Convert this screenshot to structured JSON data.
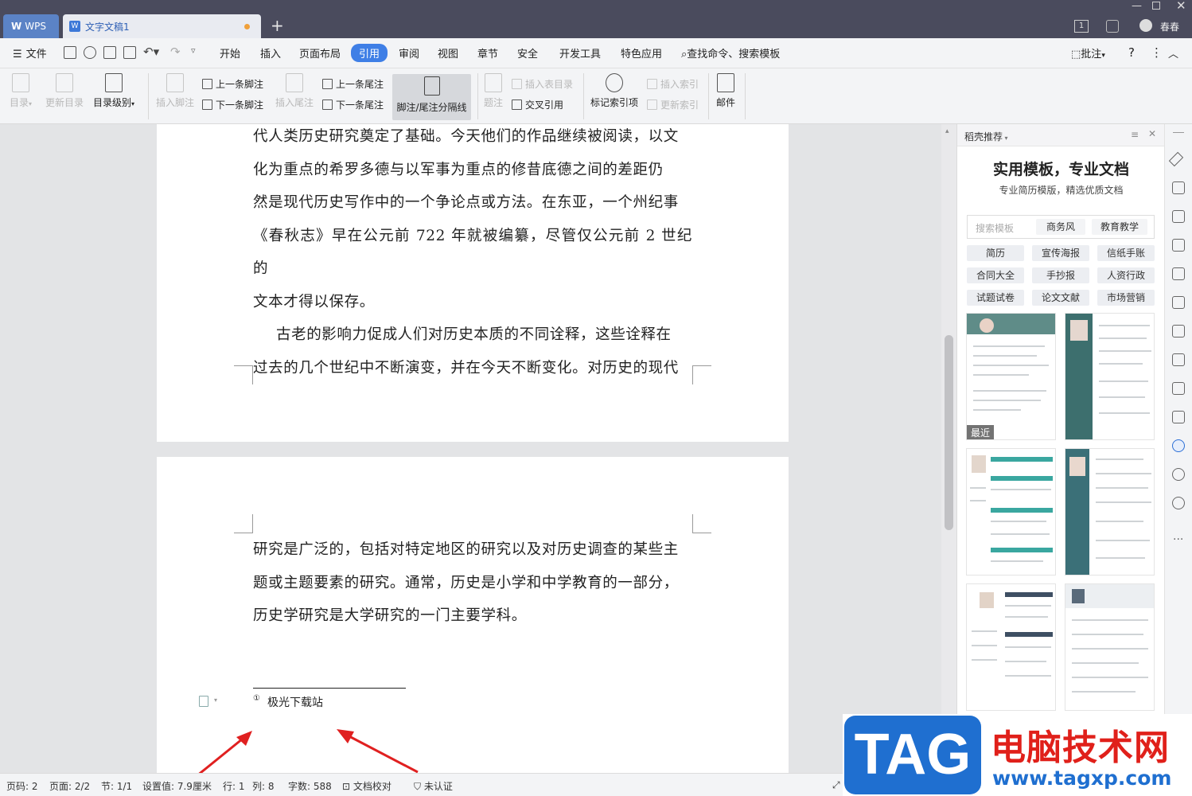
{
  "titlebar": {
    "app_tab": "WPS",
    "doc_tab": "文字文稿1",
    "new_tab": "+",
    "page_badge": "1",
    "user_name": "春春"
  },
  "menu": {
    "file": "文件",
    "items": [
      "开始",
      "插入",
      "页面布局",
      "引用",
      "审阅",
      "视图",
      "章节",
      "安全",
      "开发工具",
      "特色应用"
    ],
    "active": "引用",
    "search": "查找命令、搜索模板",
    "review": "批注",
    "help": "?"
  },
  "ribbon": {
    "toc": "目录",
    "update_toc": "更新目录",
    "toc_level": "目录级别",
    "insert_footnote": "插入脚注",
    "prev_footnote": "上一条脚注",
    "next_footnote": "下一条脚注",
    "insert_endnote": "插入尾注",
    "prev_endnote": "上一条尾注",
    "next_endnote": "下一条尾注",
    "separator": "脚注/尾注分隔线",
    "caption": "题注",
    "insert_table_toc": "插入表目录",
    "cross_ref": "交叉引用",
    "mark_index": "标记索引项",
    "insert_index": "插入索引",
    "update_index": "更新索引",
    "mail": "邮件"
  },
  "document": {
    "page1_paragraphs": [
      "代人类历史研究奠定了基础。今天他们的作品继续被阅读，以文",
      "化为重点的希罗多德与以军事为重点的修昔底德之间的差距仍",
      "然是现代历史写作中的一个争论点或方法。在东亚，一个州纪事",
      "《春秋志》早在公元前 722 年就被编纂，尽管仅公元前 2 世纪的",
      "文本才得以保存。",
      "古老的影响力促成人们对历史本质的不同诠释，这些诠释在",
      "过去的几个世纪中不断演变，并在今天不断变化。对历史的现代"
    ],
    "page2_paragraphs": [
      "研究是广泛的，包括对特定地区的研究以及对历史调查的某些主",
      "题或主题要素的研究。通常，历史是小学和中学教育的一部分，",
      "历史学研究是大学研究的一门主要学科。"
    ],
    "footnote_mark": "①",
    "footnote_text": "极光下载站"
  },
  "panel": {
    "header": "稻壳推荐",
    "title": "实用模板，专业文档",
    "subtitle": "专业简历模版，精选优质文档",
    "search_placeholder": "搜索模板",
    "search_tags": [
      "商务风",
      "教育教学"
    ],
    "chips": [
      "简历",
      "宣传海报",
      "信纸手账",
      "合同大全",
      "手抄报",
      "人资行政",
      "试题试卷",
      "论文文献",
      "市场营销"
    ],
    "recent_badge": "最近"
  },
  "statusbar": {
    "page_no": "页码: 2",
    "pages": "页面: 2/2",
    "section": "节: 1/1",
    "setting": "设置值: 7.9厘米",
    "row": "行: 1",
    "col": "列: 8",
    "words": "字数: 588",
    "proof": "文档校对",
    "auth": "未认证"
  },
  "watermark": {
    "logo": "TAG",
    "title": "电脑技术网",
    "url": "www.tagxp.com"
  },
  "colors": {
    "titlebar": "#4a4b5d",
    "accent": "#3f7fe6",
    "arrow": "#e02020",
    "watermark_blue": "#1f6fd0",
    "watermark_red": "#e0201a"
  }
}
